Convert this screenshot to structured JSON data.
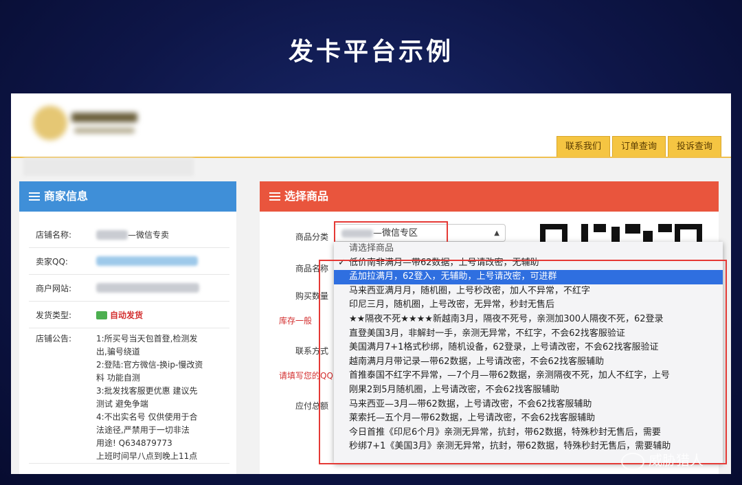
{
  "slide": {
    "title": "发卡平台示例"
  },
  "nav": {
    "tabs": [
      "联系我们",
      "订单查询",
      "投诉查询"
    ]
  },
  "merchant": {
    "header": "商家信息",
    "rows": [
      {
        "label": "店铺名称:",
        "value": "—微信专卖"
      },
      {
        "label": "卖家QQ:",
        "value": ""
      },
      {
        "label": "商户网站:",
        "value": ""
      },
      {
        "label": "发货类型:",
        "value": "自动发货"
      }
    ],
    "notice_label": "店铺公告:",
    "notice_lines": [
      "1:所买号当天包首登,检测发",
      "出,骗号绕道",
      "2:登陆:官方微信-换ip-慢改资",
      "料 功能自测",
      "3:批发找客服更优惠 建议先",
      "测试 避免争端",
      "4:不出实名号 仅供使用于合",
      "法途径,严禁用于一切非法",
      "用途! Q634879773",
      "上班时间早八点到晚上11点"
    ]
  },
  "product": {
    "header": "选择商品",
    "category_label": "商品分类",
    "category_value": "—微信专区",
    "name_label": "商品名称",
    "quantity_label": "购买数量",
    "stock_label": "库存一般",
    "contact_label": "联系方式",
    "qq_hint": "请填写您的QQ",
    "total_label": "应付总额"
  },
  "dropdown": {
    "placeholder": "请选择商品",
    "selected_index": 1,
    "checked_index": 0,
    "items": [
      "低价南非满月—带62数据，上号请改密，无辅助",
      "孟加拉满月，62登入，无辅助，上号请改密，可进群",
      "马来西亚满月月，随机圈，上号秒改密，加人不异常，不红字",
      "印尼三月，随机圈，上号改密，无异常，秒封无售后",
      "★★隔夜不死★★★★新越南3月，隔夜不死号，亲测加300人隔夜不死，62登录",
      "直登美国3月，非解封一手，亲测无异常，不红字，不会62找客服验证",
      "美国满月7+1格式秒绑，随机设备，62登录，上号请改密，不会62找客服验证",
      "越南满月月带记录—带62数据，上号请改密，不会62找客服辅助",
      "首推泰国不红字不异常，—7个月—带62数据，亲测隔夜不死，加人不红字，上号",
      "刚果2到5月随机圈，上号请改密，不会62找客服辅助",
      "马来西亚—3月—带62数据，上号请改密，不会62找客服辅助",
      "莱索托—五个月—带62数据，上号请改密，不会62找客服辅助",
      "今日首推《印尼6个月》亲测无异常，抗封，带62数据，特殊秒封无售后，需要",
      "秒绑7+1《美国3月》亲测无异常，抗封，带62数据，特殊秒封无售后，需要辅助"
    ]
  },
  "watermark": {
    "text": "威胁猎人"
  }
}
